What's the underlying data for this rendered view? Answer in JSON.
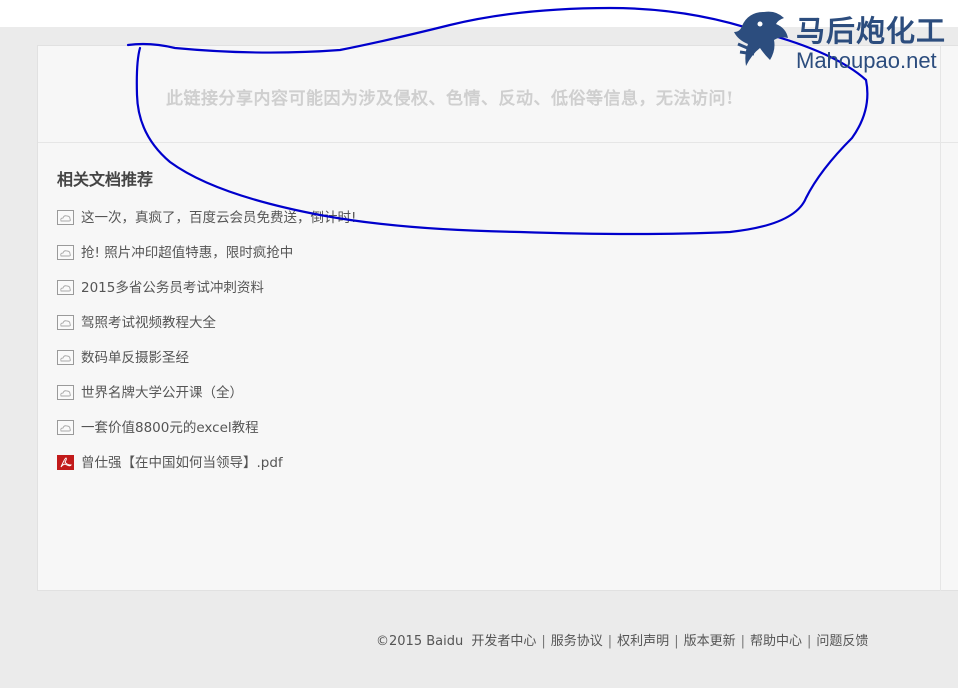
{
  "notice": "此链接分享内容可能因为涉及侵权、色情、反动、低俗等信息，无法访问!",
  "related": {
    "title": "相关文档推荐",
    "items": [
      {
        "label": "这一次，真疯了，百度云会员免费送，倒计时!",
        "icon": "cloud-doc-icon"
      },
      {
        "label": "抢! 照片冲印超值特惠，限时疯抢中",
        "icon": "cloud-doc-icon"
      },
      {
        "label": "2015多省公务员考试冲刺资料",
        "icon": "cloud-doc-icon"
      },
      {
        "label": "驾照考试视频教程大全",
        "icon": "cloud-doc-icon"
      },
      {
        "label": "数码单反摄影圣经",
        "icon": "cloud-doc-icon"
      },
      {
        "label": "世界名牌大学公开课（全）",
        "icon": "cloud-doc-icon"
      },
      {
        "label": "一套价值8800元的excel教程",
        "icon": "cloud-doc-icon"
      },
      {
        "label": "曾仕强【在中国如何当领导】.pdf",
        "icon": "pdf-icon"
      }
    ]
  },
  "footer": {
    "copyright": "©2015 Baidu",
    "links": [
      "开发者中心",
      "服务协议",
      "权利声明",
      "版本更新",
      "帮助中心",
      "问题反馈"
    ],
    "separator": "|"
  },
  "watermark": {
    "cn": "马后炮化工",
    "en": "Mahoupao.net"
  },
  "colors": {
    "annotation": "#0000cc",
    "logo": "#2c4d7e",
    "pdf": "#c21a1a"
  }
}
